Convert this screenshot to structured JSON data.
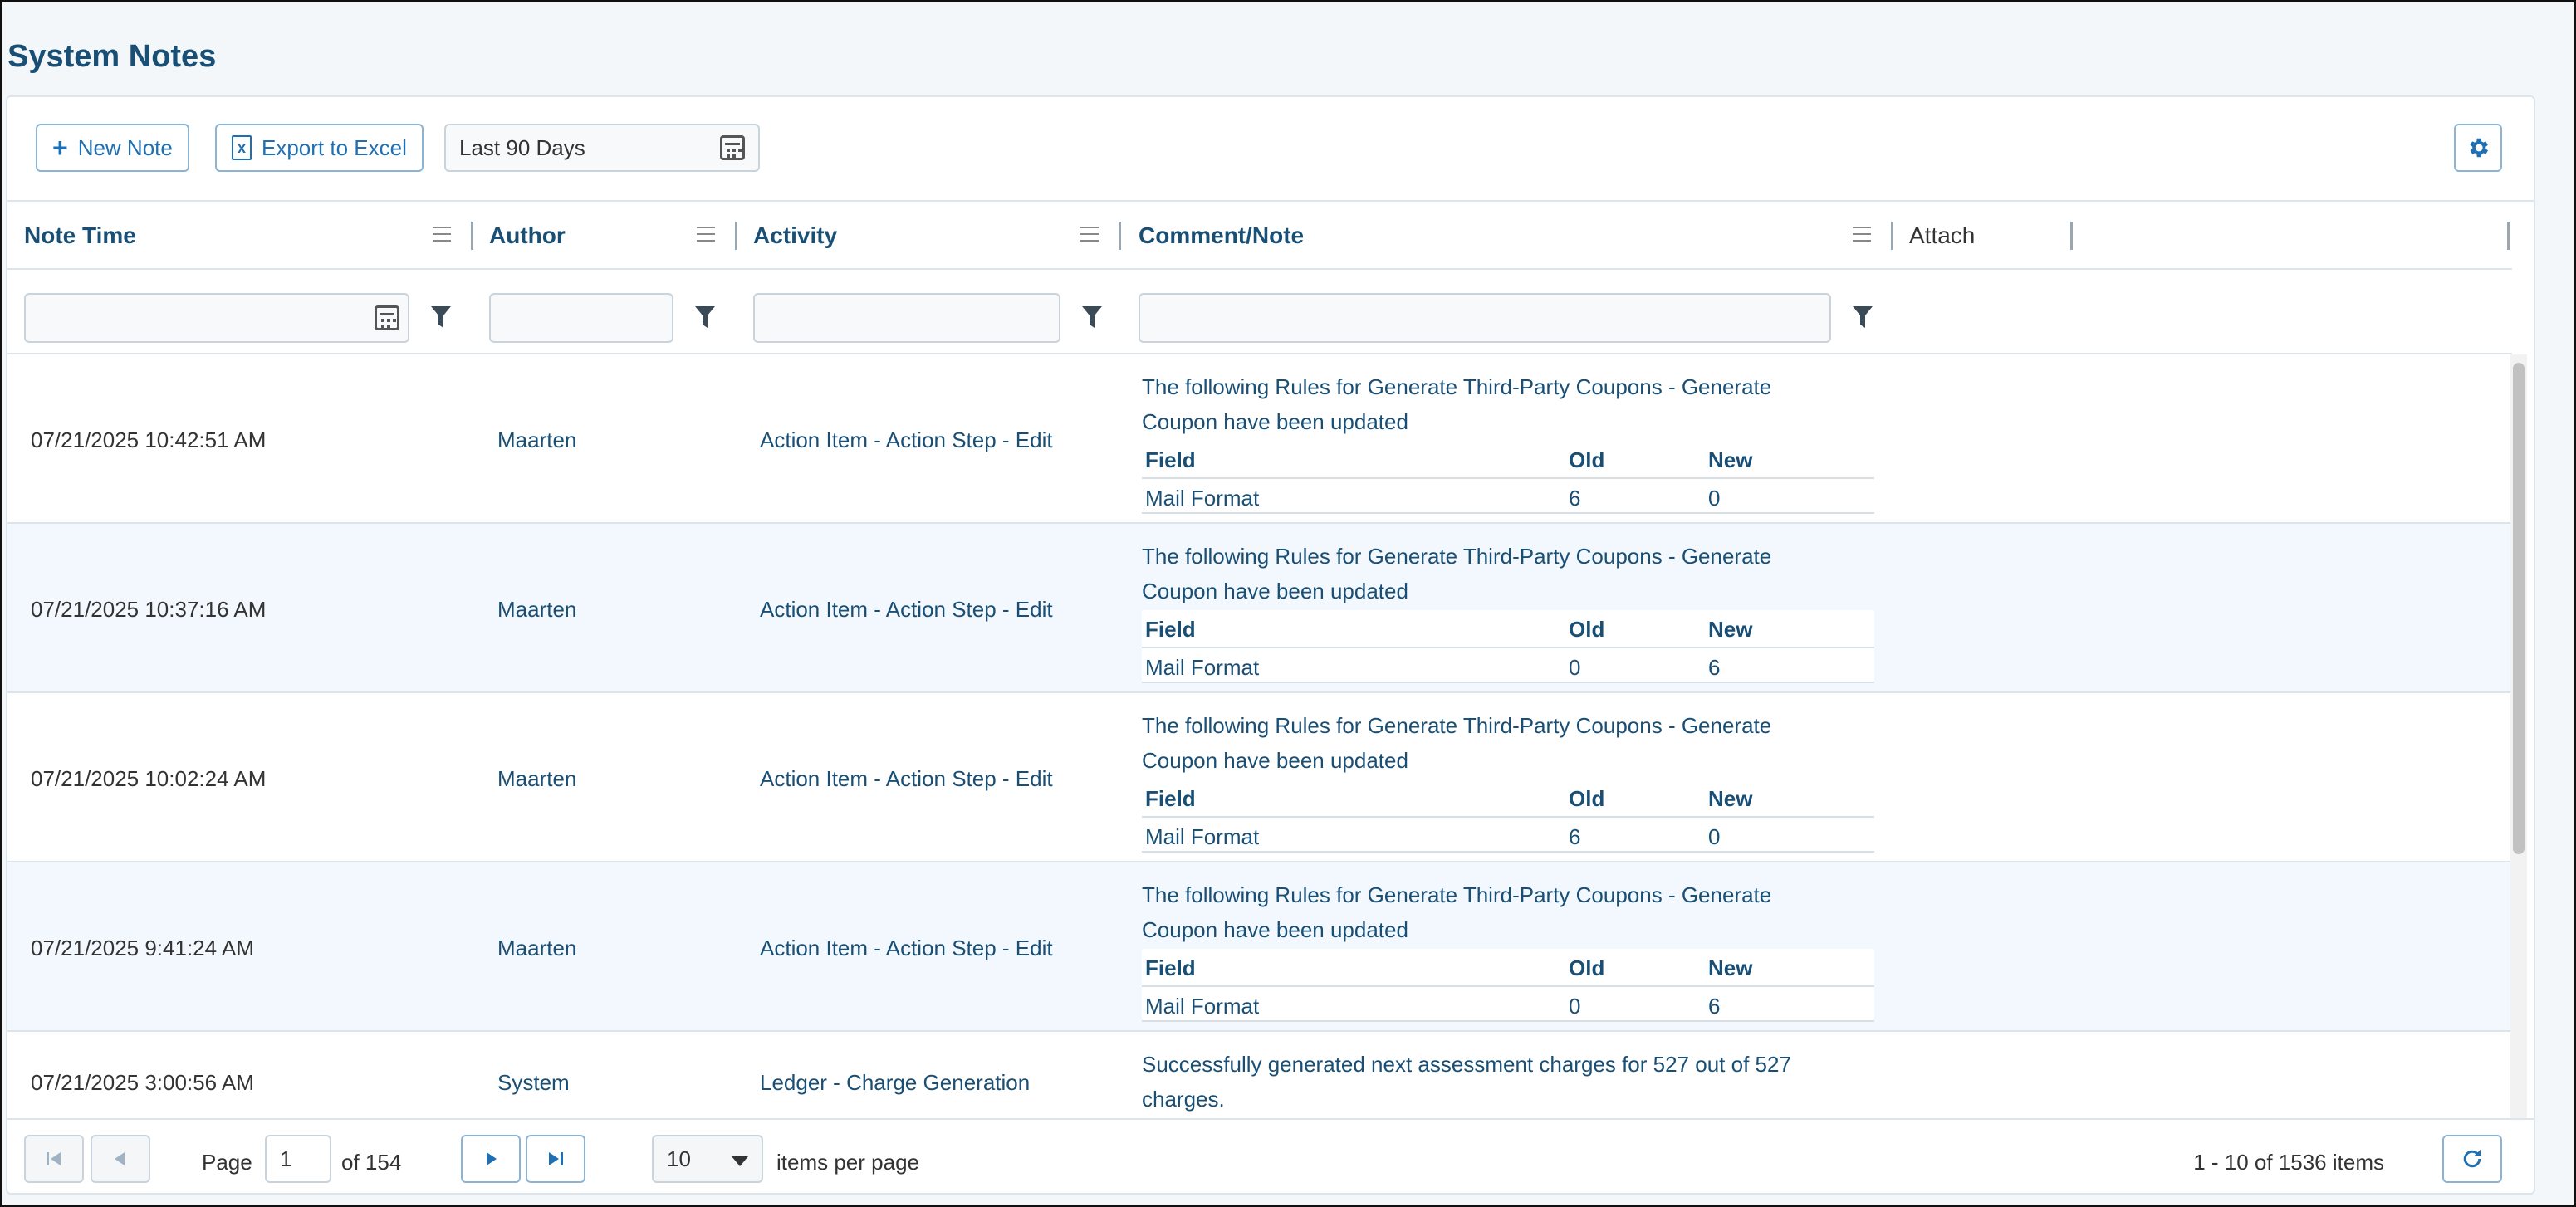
{
  "page": {
    "title": "System Notes"
  },
  "toolbar": {
    "new_note_label": "New Note",
    "export_label": "Export to Excel",
    "date_range_value": "Last 90 Days"
  },
  "columns": {
    "note_time": "Note Time",
    "author": "Author",
    "activity": "Activity",
    "comment": "Comment/Note",
    "attach": "Attach"
  },
  "rows": [
    {
      "time": "07/21/2025 10:42:51 AM",
      "author": "Maarten",
      "activity": "Action Item - Action Step - Edit",
      "comment": "The following Rules for Generate Third-Party Coupons - Generate Coupon have been updated",
      "table": {
        "h_field": "Field",
        "h_old": "Old",
        "h_new": "New",
        "field": "Mail Format",
        "old": "6",
        "new": "0"
      }
    },
    {
      "time": "07/21/2025 10:37:16 AM",
      "author": "Maarten",
      "activity": "Action Item - Action Step - Edit",
      "comment": "The following Rules for Generate Third-Party Coupons - Generate Coupon have been updated",
      "table": {
        "h_field": "Field",
        "h_old": "Old",
        "h_new": "New",
        "field": "Mail Format",
        "old": "0",
        "new": "6"
      }
    },
    {
      "time": "07/21/2025 10:02:24 AM",
      "author": "Maarten",
      "activity": "Action Item - Action Step - Edit",
      "comment": "The following Rules for Generate Third-Party Coupons - Generate Coupon have been updated",
      "table": {
        "h_field": "Field",
        "h_old": "Old",
        "h_new": "New",
        "field": "Mail Format",
        "old": "6",
        "new": "0"
      }
    },
    {
      "time": "07/21/2025 9:41:24 AM",
      "author": "Maarten",
      "activity": "Action Item - Action Step - Edit",
      "comment": "The following Rules for Generate Third-Party Coupons - Generate Coupon have been updated",
      "table": {
        "h_field": "Field",
        "h_old": "Old",
        "h_new": "New",
        "field": "Mail Format",
        "old": "0",
        "new": "6"
      }
    },
    {
      "time": "07/21/2025 3:00:56 AM",
      "author": "System",
      "activity": "Ledger - Charge Generation",
      "comment": "Successfully generated next assessment charges for 527 out of 527 charges."
    }
  ],
  "pager": {
    "page_label": "Page",
    "current_page": "1",
    "of_label": "of 154",
    "per_page_value": "10",
    "per_page_label": "items per page",
    "summary": "1 - 10 of 1536 items"
  },
  "colors": {
    "accent": "#1f6fb2",
    "header_text": "#1a4f75",
    "alt_row": "#f2f8fd"
  }
}
